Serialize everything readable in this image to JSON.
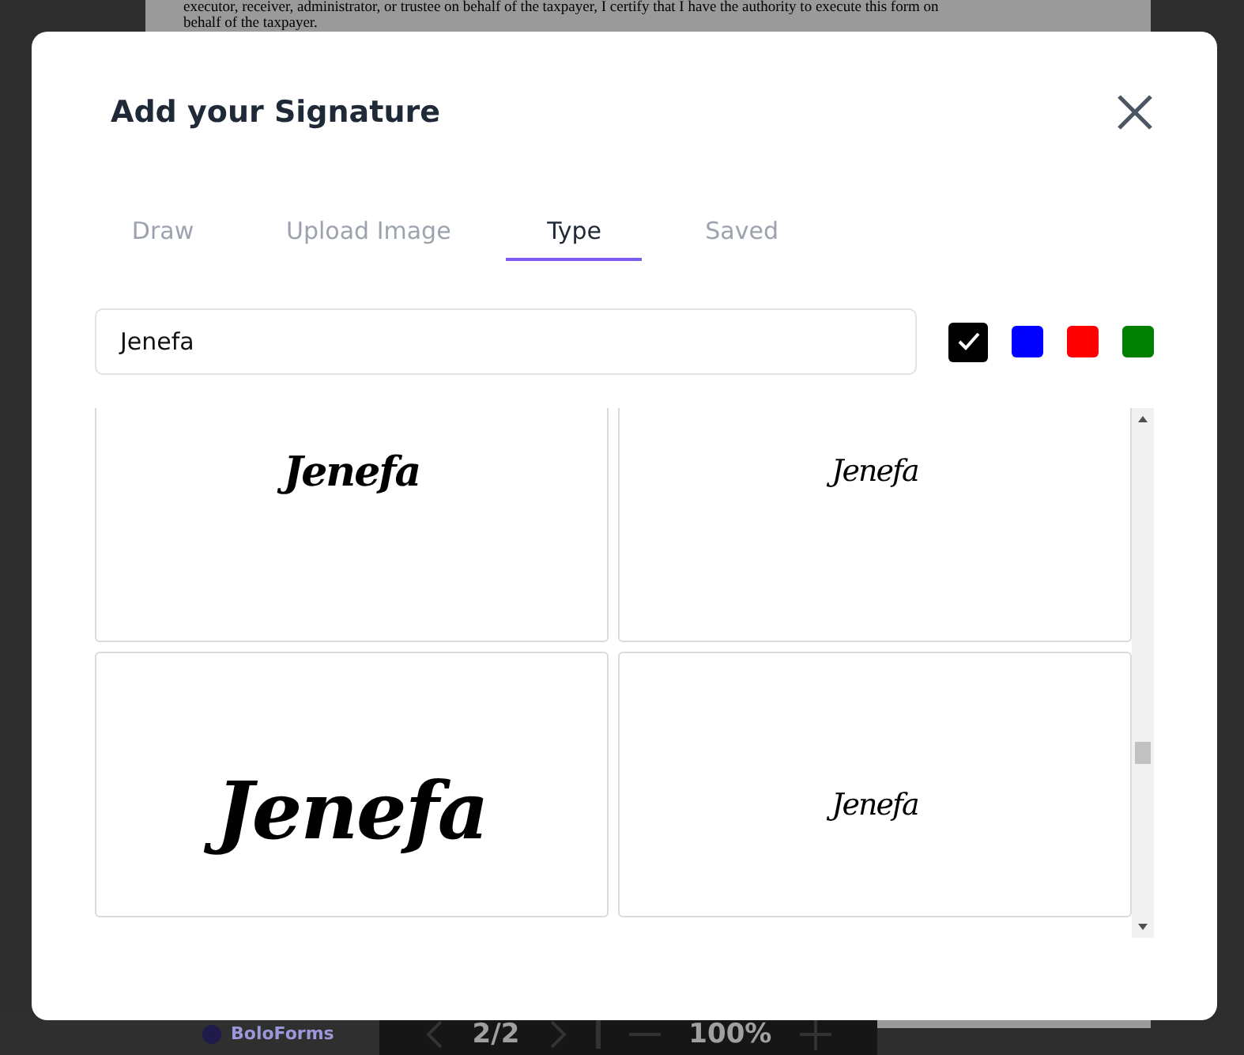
{
  "document": {
    "lines": [
      "executor, receiver, administrator, or trustee on behalf of the taxpayer, I certify that I have the authority to execute this form on",
      "behalf of the taxpayer."
    ]
  },
  "dialog": {
    "title": "Add your Signature",
    "tabs": [
      {
        "label": "Draw",
        "selected": false
      },
      {
        "label": "Upload Image",
        "selected": false
      },
      {
        "label": "Type",
        "selected": true
      },
      {
        "label": "Saved",
        "selected": false
      }
    ],
    "name_field": {
      "value": "Jenefa"
    },
    "colors": [
      {
        "color": "#000000",
        "selected": true
      },
      {
        "color": "#0000ff",
        "selected": false
      },
      {
        "color": "#ff0000",
        "selected": false
      },
      {
        "color": "#008000",
        "selected": false
      }
    ],
    "signatures": [
      {
        "text": "Jenefa"
      },
      {
        "text": "Jenefa"
      },
      {
        "text": "Jenefa"
      },
      {
        "text": "Jenefa"
      }
    ]
  },
  "toolbar": {
    "brand": "BoloForms",
    "page": "2/2",
    "zoom": "100%"
  }
}
